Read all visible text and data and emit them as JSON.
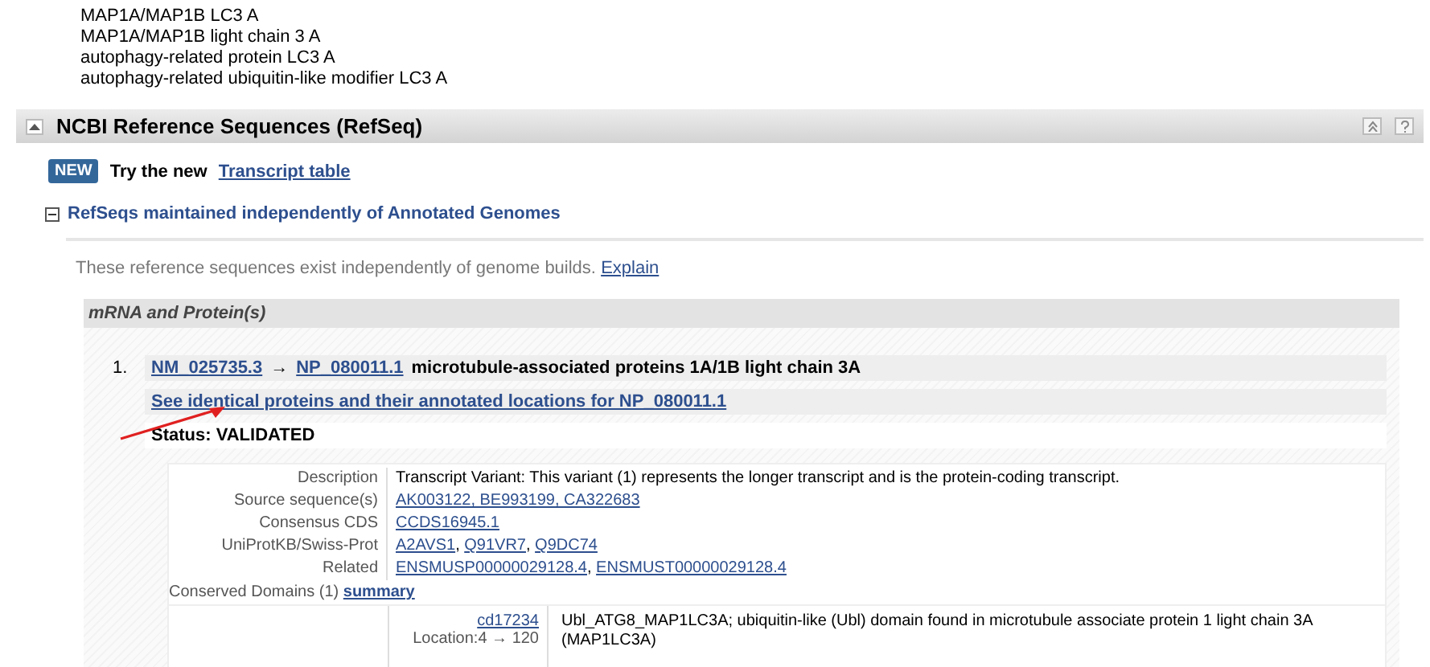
{
  "names": [
    "MAP1A/MAP1B LC3 A",
    "MAP1A/MAP1B light chain 3 A",
    "autophagy-related protein LC3 A",
    "autophagy-related ubiquitin-like modifier LC3 A"
  ],
  "section": {
    "title": "NCBI Reference Sequences (RefSeq)",
    "expanded": true
  },
  "promo": {
    "badge": "NEW",
    "text": "Try the new",
    "link": "Transcript table"
  },
  "subsection": {
    "title": "RefSeqs maintained independently of Annotated Genomes",
    "expanded": true
  },
  "intro": {
    "text": "These reference sequences exist independently of genome builds.",
    "link": "Explain"
  },
  "panel": {
    "title": "mRNA and Protein(s)",
    "item": {
      "number": "1.",
      "mrna": "NM_025735.3",
      "arrow": "→",
      "protein": "NP_080011.1",
      "name": "microtubule-associated proteins 1A/1B light chain 3A",
      "identical_link": "See identical proteins and their annotated locations for NP_080011.1",
      "status": "Status: VALIDATED",
      "details": [
        {
          "label": "Description",
          "kind": "text",
          "values": [
            "Transcript Variant: This variant (1) represents the longer transcript and is the protein-coding transcript."
          ]
        },
        {
          "label": "Source sequence(s)",
          "kind": "links",
          "values": [
            "AK003122, BE993199, CA322683"
          ]
        },
        {
          "label": "Consensus CDS",
          "kind": "links",
          "values": [
            "CCDS16945.1"
          ]
        },
        {
          "label": "UniProtKB/Swiss-Prot",
          "kind": "links",
          "separator": ",",
          "values": [
            "A2AVS1",
            "Q91VR7",
            "Q9DC74"
          ]
        },
        {
          "label": "Related",
          "kind": "links",
          "separator": ",",
          "values": [
            "ENSMUSP00000029128.4",
            "ENSMUST00000029128.4"
          ]
        }
      ],
      "domains": {
        "label": "Conserved Domains (1)",
        "link": "summary",
        "rows": [
          {
            "id": "cd17234",
            "location": "Location:4 → 120",
            "description": "Ubl_ATG8_MAP1LC3A; ubiquitin-like (Ubl) domain found in microtubule associate protein 1 light chain 3A (MAP1LC3A)"
          }
        ]
      }
    }
  }
}
